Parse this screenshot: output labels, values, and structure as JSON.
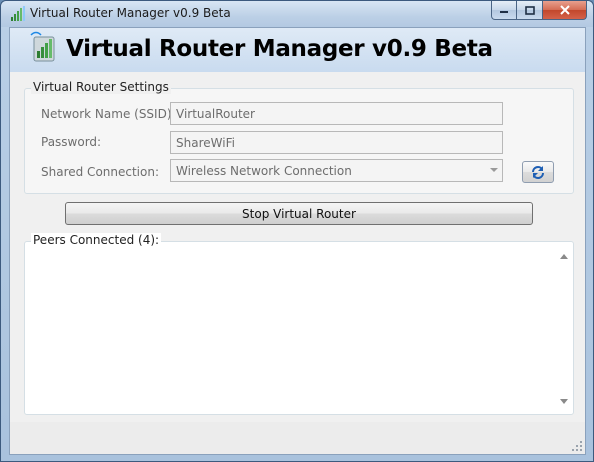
{
  "window": {
    "title": "Virtual Router Manager v0.9 Beta",
    "caption_buttons": {
      "minimize_icon": "minimize-icon",
      "maximize_icon": "maximize-icon",
      "close_icon": "close-icon"
    }
  },
  "header": {
    "app_title": "Virtual Router Manager v0.9 Beta",
    "logo_icon": "wifi-signal-icon"
  },
  "settings": {
    "group_label": "Virtual Router Settings",
    "ssid": {
      "label": "Network Name (SSID):",
      "value": "VirtualRouter"
    },
    "password": {
      "label": "Password:",
      "value": "ShareWiFi"
    },
    "shared_connection": {
      "label": "Shared Connection:",
      "selected": "Wireless Network Connection"
    },
    "refresh_icon": "refresh-icon"
  },
  "actions": {
    "toggle_router_label": "Stop Virtual Router"
  },
  "peers": {
    "group_label": "Peers Connected (4):",
    "items": []
  },
  "colors": {
    "title_bar": "#bcd0e6",
    "client_bg": "#f0f0f0",
    "close_button": "#c2472c",
    "disabled_text": "#6d6d6d"
  }
}
